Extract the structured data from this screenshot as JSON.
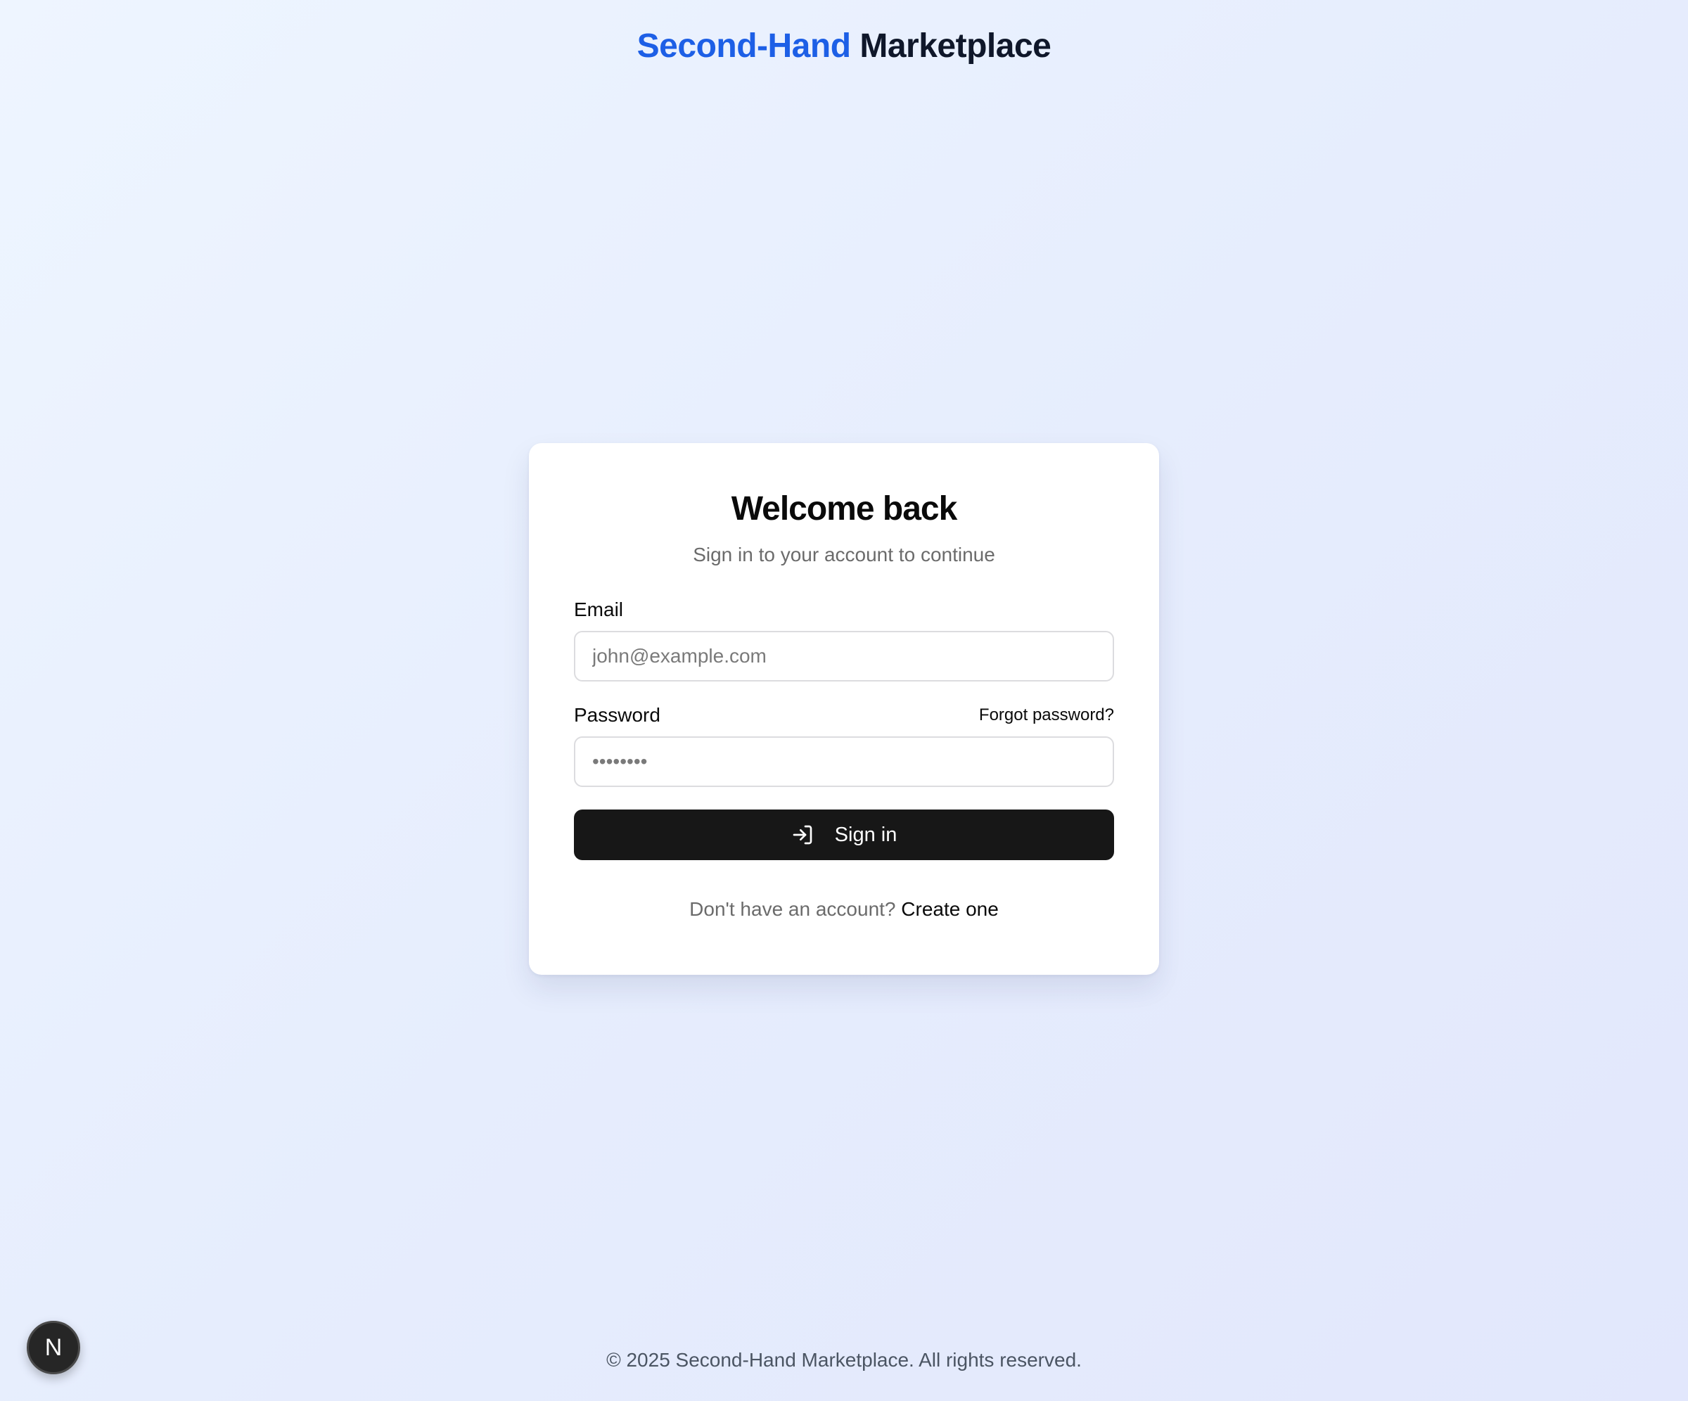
{
  "header": {
    "brand_accent": "Second-Hand",
    "brand_rest": "Marketplace"
  },
  "login": {
    "title": "Welcome back",
    "subtitle": "Sign in to your account to continue",
    "email_label": "Email",
    "email_placeholder": "john@example.com",
    "password_label": "Password",
    "password_placeholder": "••••••••",
    "forgot_link": "Forgot password?",
    "submit_label": "Sign in",
    "signup_prompt": "Don't have an account?",
    "signup_link": "Create one"
  },
  "footer": {
    "copyright": "© 2025 Second-Hand Marketplace. All rights reserved."
  },
  "dev_badge": {
    "letter": "N"
  },
  "colors": {
    "brand_accent": "#1d5fe6",
    "primary_button": "#171717"
  },
  "icons": {
    "submit_icon": "log-in-icon",
    "dev_badge_icon": "nextjs-icon"
  }
}
